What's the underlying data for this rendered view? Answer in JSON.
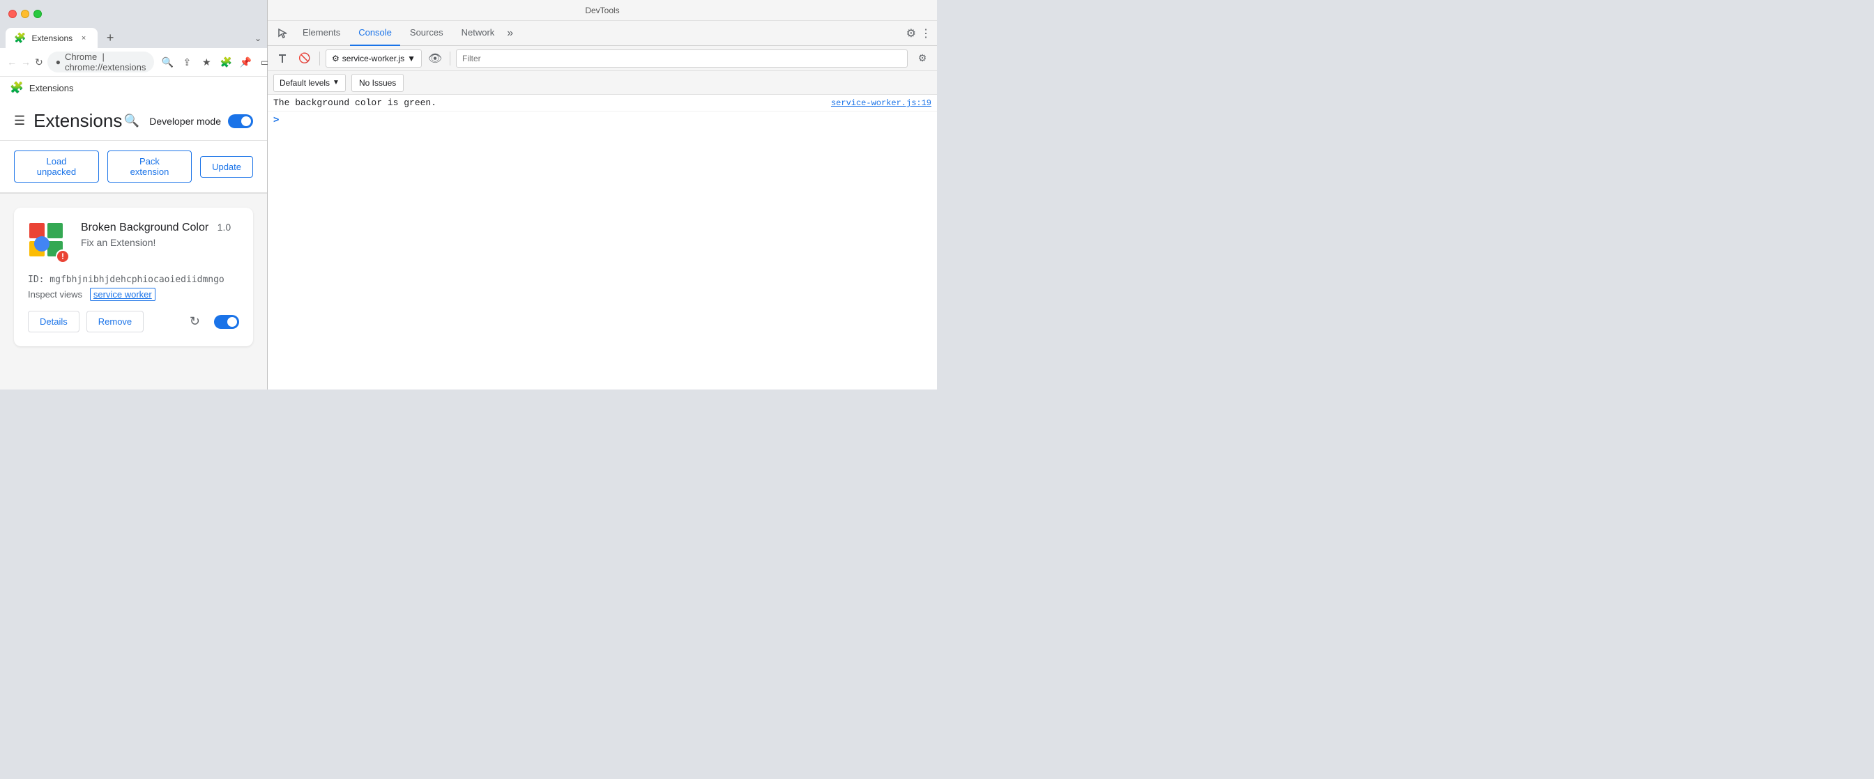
{
  "browser": {
    "title": "DevTools",
    "tab": {
      "icon": "🧩",
      "title": "Extensions",
      "close": "×"
    },
    "address": {
      "protocol": "Chrome",
      "separator": " | ",
      "url": "chrome://extensions"
    },
    "breadcrumb": {
      "icon": "🧩",
      "text": "Extensions"
    }
  },
  "extensions_page": {
    "title": "Extensions",
    "dev_mode_label": "Developer mode",
    "buttons": {
      "load_unpacked": "Load unpacked",
      "pack_extension": "Pack extension",
      "update": "Update"
    },
    "extension": {
      "name": "Broken Background Color",
      "version": "1.0",
      "description": "Fix an Extension!",
      "id_label": "ID: mgfbhjnibhjdehcphiocaoiediidmngo",
      "inspect_label": "Inspect views",
      "inspect_link": "service worker",
      "details_btn": "Details",
      "remove_btn": "Remove"
    }
  },
  "devtools": {
    "title": "DevTools",
    "tabs": [
      "Elements",
      "Console",
      "Sources",
      "Network"
    ],
    "active_tab": "Console",
    "overflow": "»",
    "toolbar": {
      "context": "service-worker.js",
      "filter_placeholder": "Filter"
    },
    "levels": {
      "label": "Default levels",
      "issues": "No Issues"
    },
    "console_messages": [
      {
        "text": "The background color is green.",
        "source": "service-worker.js:19"
      }
    ],
    "prompt": ">"
  }
}
